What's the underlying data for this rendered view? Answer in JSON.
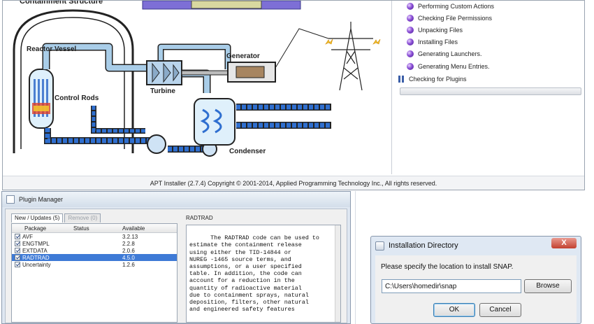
{
  "installer": {
    "diagram": {
      "title": "Containment Structure",
      "labels": {
        "reactor_vessel": "Reactor Vessel",
        "control_rods": "Control Rods",
        "turbine": "Turbine",
        "generator": "Generator",
        "condenser": "Condenser"
      }
    },
    "steps": [
      {
        "label": "Performing Custom Actions",
        "icon": "purple-sphere-icon"
      },
      {
        "label": "Checking File Permissions",
        "icon": "purple-sphere-icon"
      },
      {
        "label": "Unpacking Files",
        "icon": "purple-sphere-icon"
      },
      {
        "label": "Installing Files",
        "icon": "purple-sphere-icon"
      },
      {
        "label": "Generating Launchers.",
        "icon": "purple-sphere-icon"
      },
      {
        "label": "Generating Menu Entries.",
        "icon": "purple-sphere-icon"
      },
      {
        "label": "Checking for Plugins",
        "icon": "pause-icon"
      }
    ],
    "progress_fraction": 0,
    "copyright": "APT Installer (2.7.4) Copyright © 2001-2014, Applied Programming Technology Inc., All rights reserved."
  },
  "plugin_manager": {
    "title": "Plugin Manager",
    "tabs": [
      {
        "label": "New / Updates (5)",
        "active": true
      },
      {
        "label": "Remove (0)",
        "active": false
      }
    ],
    "columns": [
      "Package",
      "Status",
      "Available"
    ],
    "rows": [
      {
        "name": "AVF",
        "status": "",
        "available": "3.2.13",
        "checked": true,
        "selected": false
      },
      {
        "name": "ENGTMPL",
        "status": "",
        "available": "2.2.8",
        "checked": true,
        "selected": false
      },
      {
        "name": "EXTDATA",
        "status": "",
        "available": "2.0.6",
        "checked": true,
        "selected": false
      },
      {
        "name": "RADTRAD",
        "status": "",
        "available": "4.5.0",
        "checked": true,
        "selected": true
      },
      {
        "name": "Uncertainty",
        "status": "",
        "available": "1.2.6",
        "checked": true,
        "selected": false
      }
    ],
    "description_title": "RADTRAD",
    "description": "The RADTRAD code can be used to\nestimate the containment release\nusing either the TID-14844 or\nNUREG -1465 source terms, and\nassumptions, or a user specified\ntable. In addition, the code can\naccount for a reduction in the\nquantity of radioactive material\ndue to containment sprays, natural\ndeposition, filters, other natural\nand engineered safety features"
  },
  "install_dir_dialog": {
    "title": "Installation Directory",
    "close_label": "X",
    "prompt": "Please specify the location to install SNAP.",
    "path_value": "C:\\Users\\homedir\\snap",
    "browse_label": "Browse",
    "ok_label": "OK",
    "cancel_label": "Cancel"
  },
  "colors": {
    "pipe_blue": "#2f6fd0",
    "pipe_light": "#a9cde8",
    "diagram_ink": "#222222",
    "purple_banner": "#7d6fd6",
    "selection": "#3e7ad6",
    "core_red": "#e0402a",
    "core_yellow": "#f2c230"
  }
}
